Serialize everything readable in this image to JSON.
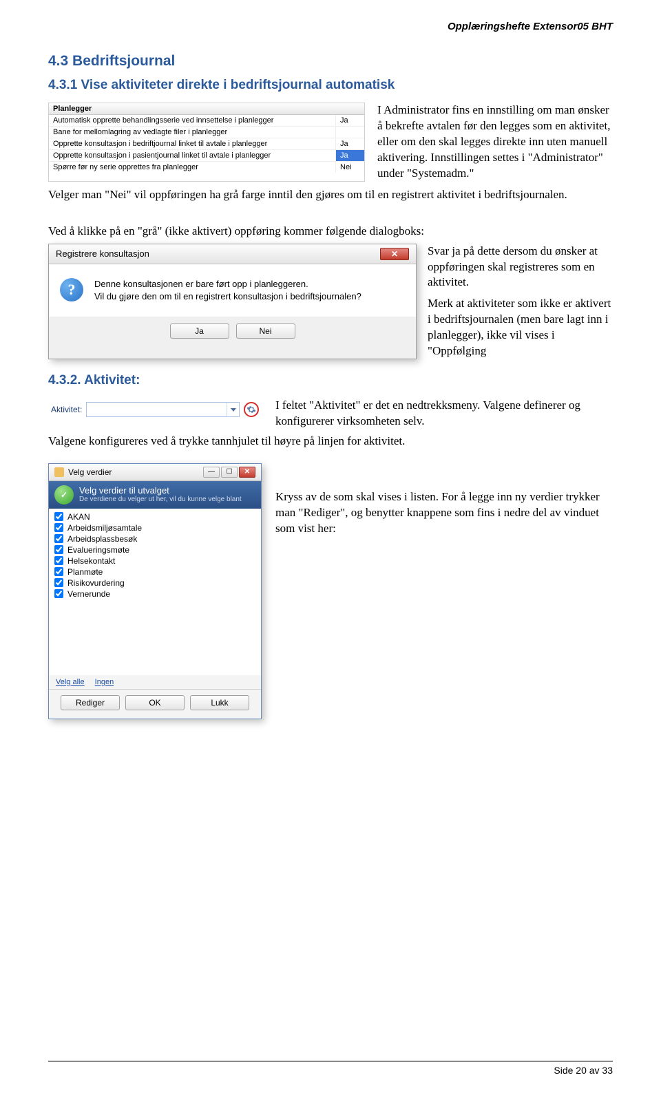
{
  "doc_header": "Opplæringshefte Extensor05 BHT",
  "section_title": "4.3 Bedriftsjournal",
  "subsection1_title": "4.3.1 Vise aktiviteter direkte i bedriftsjournal automatisk",
  "planlegger": {
    "header": "Planlegger",
    "rows": [
      {
        "label": "Automatisk opprette behandlingsserie ved innsettelse i planlegger",
        "value": "Ja"
      },
      {
        "label": "Bane for mellomlagring av vedlagte filer i planlegger",
        "value": ""
      },
      {
        "label": "Opprette konsultasjon i bedriftjournal linket til avtale i planlegger",
        "value": "Ja"
      },
      {
        "label": "Opprette konsultasjon i pasientjournal linket til avtale i planlegger",
        "value": "Ja"
      },
      {
        "label": "Spørre før ny serie opprettes fra planlegger",
        "value": "Nei"
      }
    ]
  },
  "row1_text": "I Administrator fins en innstilling om man ønsker å bekrefte avtalen før den legges som en aktivitet, eller om den skal legges direkte inn uten manuell aktivering. Innstillingen settes i \"Administrator\" under \"Systemadm.\"",
  "para_after_row1": "Velger man \"Nei\" vil oppføringen ha grå farge inntil den gjøres om til en registrert aktivitet i bedriftsjournalen.",
  "dialog_intro": "Ved å klikke på en \"grå\" (ikke aktivert) oppføring kommer følgende dialogboks:",
  "msgbox": {
    "title": "Registrere konsultasjon",
    "line1": "Denne konsultasjonen er bare ført opp i planleggeren.",
    "line2": "Vil du gjøre den om til en registrert konsultasjon i bedriftsjournalen?",
    "yes": "Ja",
    "no": "Nei"
  },
  "dialog_side_p1": "Svar ja på dette dersom du ønsker at oppføringen skal registreres som en aktivitet.",
  "dialog_side_p2": "Merk at aktiviteter som ikke er aktivert i bedriftsjournalen (men bare lagt inn i planlegger), ikke vil vises i \"Oppfølging",
  "subsection2_title": "4.3.2. Aktivitet:",
  "aktivitet_label": "Aktivitet:",
  "aktivitet_side": "I feltet \"Aktivitet\" er det en nedtrekksmeny. Valgene definerer og konfigurerer virksomheten selv.",
  "aktivitet_after": "Valgene konfigureres ved å trykke tannhjulet til høyre på linjen for aktivitet.",
  "velg": {
    "title": "Velg verdier",
    "banner_title": "Velg verdier til utvalget",
    "banner_sub": "De verdiene du velger ut her, vil du kunne velge blant",
    "items": [
      "AKAN",
      "Arbeidsmiljøsamtale",
      "Arbeidsplassbesøk",
      "Evalueringsmøte",
      "Helsekontakt",
      "Planmøte",
      "Risikovurdering",
      "Vernerunde"
    ],
    "link_all": "Velg alle",
    "link_none": "Ingen",
    "btn_edit": "Rediger",
    "btn_ok": "OK",
    "btn_close": "Lukk"
  },
  "velg_side": "Kryss av de som skal vises i listen. For å legge inn ny verdier trykker man \"Rediger\", og benytter knappene som fins i nedre del av vinduet som vist her:",
  "footer": "Side 20 av 33"
}
